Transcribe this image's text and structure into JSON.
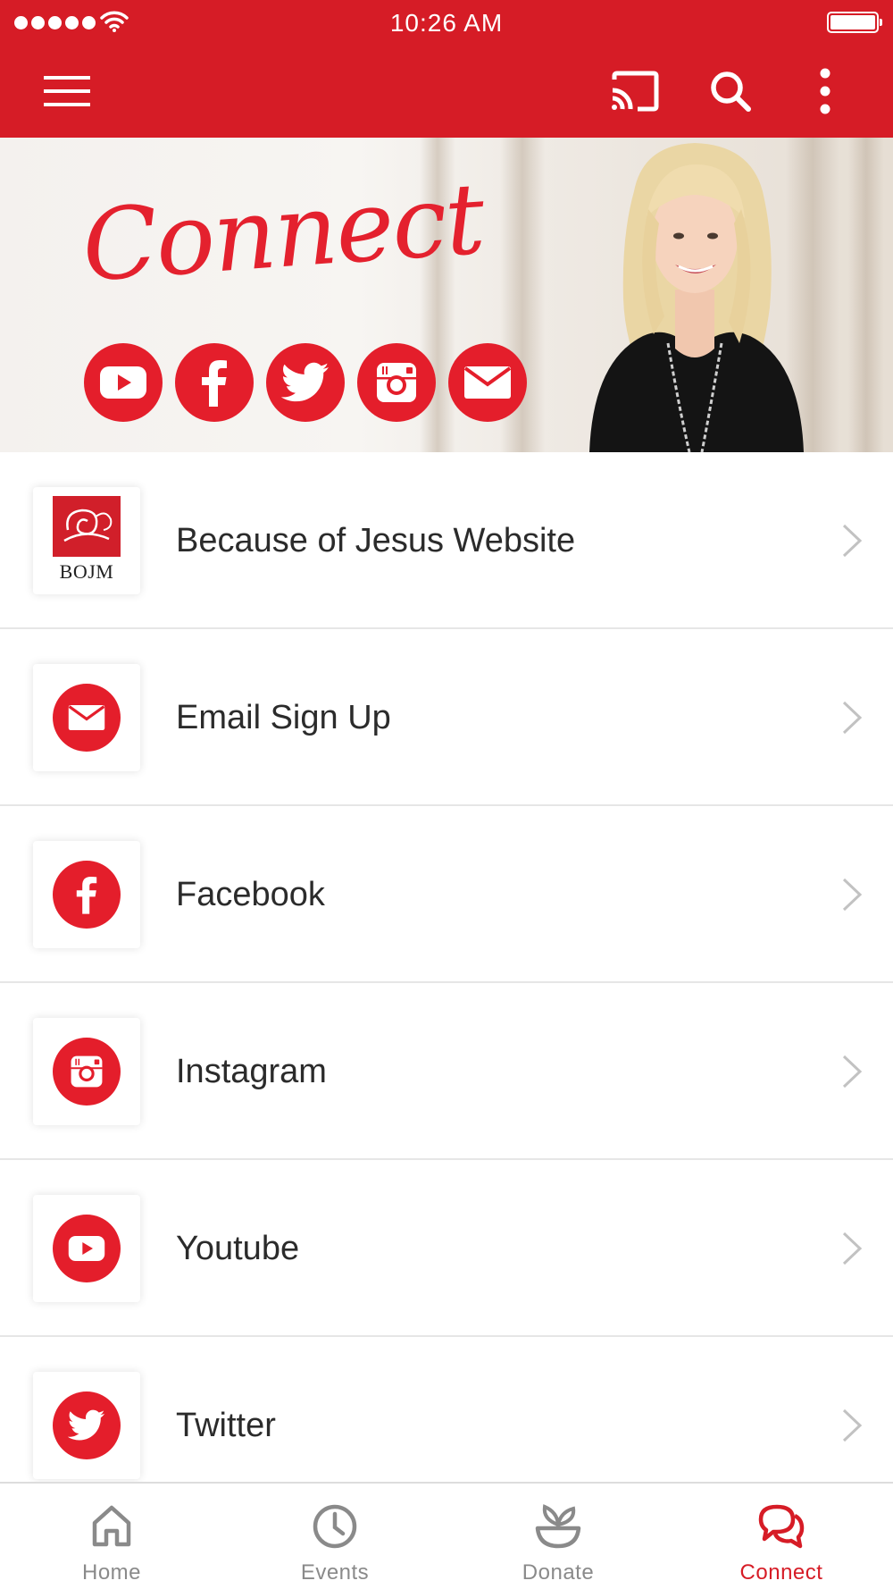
{
  "status_bar": {
    "time": "10:26 AM"
  },
  "theme": {
    "brand": "#d61c26",
    "icon_red": "#e41e2b",
    "inactive": "#8a8a8a"
  },
  "app_bar": {
    "icons": [
      "menu-icon",
      "cast-icon",
      "search-icon",
      "more-vertical-icon"
    ]
  },
  "hero": {
    "title": "Connect",
    "social_icons": [
      "youtube-icon",
      "facebook-icon",
      "twitter-icon",
      "instagram-icon",
      "email-icon"
    ]
  },
  "list": {
    "items": [
      {
        "label": "Because of Jesus Website",
        "icon": "bojm-logo",
        "logo_text": "BOJM"
      },
      {
        "label": "Email Sign Up",
        "icon": "email-icon"
      },
      {
        "label": "Facebook",
        "icon": "facebook-icon"
      },
      {
        "label": "Instagram",
        "icon": "instagram-icon"
      },
      {
        "label": "Youtube",
        "icon": "youtube-icon"
      },
      {
        "label": "Twitter",
        "icon": "twitter-icon"
      }
    ]
  },
  "bottom_nav": {
    "items": [
      {
        "label": "Home",
        "icon": "home-icon",
        "active": false
      },
      {
        "label": "Events",
        "icon": "clock-icon",
        "active": false
      },
      {
        "label": "Donate",
        "icon": "plant-icon",
        "active": false
      },
      {
        "label": "Connect",
        "icon": "chat-bubbles-icon",
        "active": true
      }
    ]
  }
}
